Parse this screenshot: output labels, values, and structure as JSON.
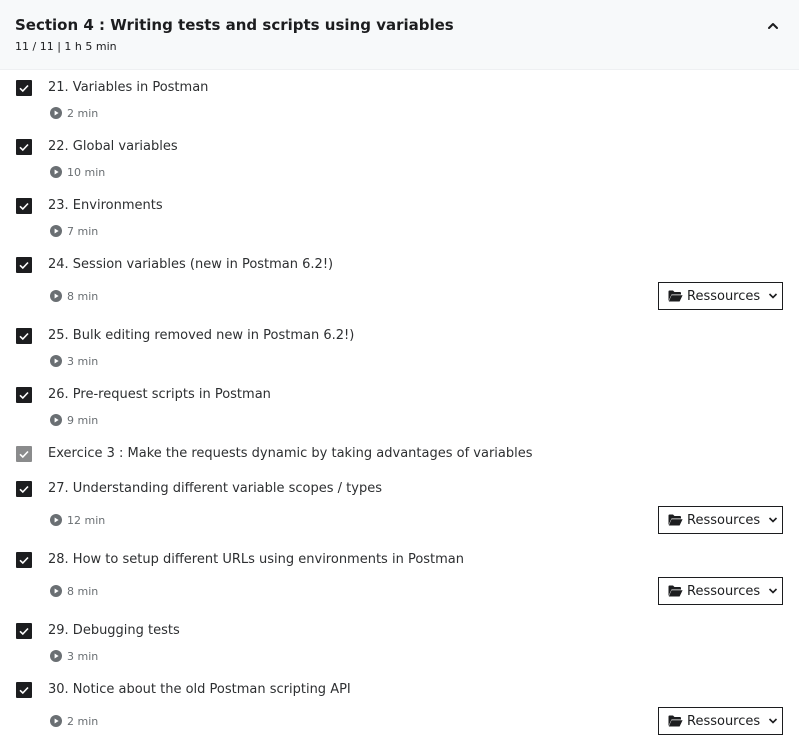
{
  "section": {
    "title": "Section 4 : Writing tests and scripts using variables",
    "meta": "11 / 11 | 1 h 5 min"
  },
  "resources_label": "Ressources",
  "items": [
    {
      "title": "21. Variables in Postman",
      "duration": "2 min",
      "checked": true
    },
    {
      "title": "22. Global variables",
      "duration": "10 min",
      "checked": true
    },
    {
      "title": "23. Environments",
      "duration": "7 min",
      "checked": true
    },
    {
      "title": "24. Session variables (new in Postman 6.2!)",
      "duration": "8 min",
      "checked": true
    },
    {
      "title": "25. Bulk editing removed new in Postman 6.2!)",
      "duration": "3 min",
      "checked": true
    },
    {
      "title": "26. Pre-request scripts in Postman",
      "duration": "9 min",
      "checked": true
    },
    {
      "title": "Exercice 3 : Make the requests dynamic by taking advantages of variables",
      "checked": true
    },
    {
      "title": "27. Understanding different variable scopes / types",
      "duration": "12 min",
      "checked": true
    },
    {
      "title": "28. How to setup different URLs using environments in Postman",
      "duration": "8 min",
      "checked": true
    },
    {
      "title": "29. Debugging tests",
      "duration": "3 min",
      "checked": true
    },
    {
      "title": "30. Notice about the old Postman scripting API",
      "duration": "2 min",
      "checked": true
    }
  ]
}
